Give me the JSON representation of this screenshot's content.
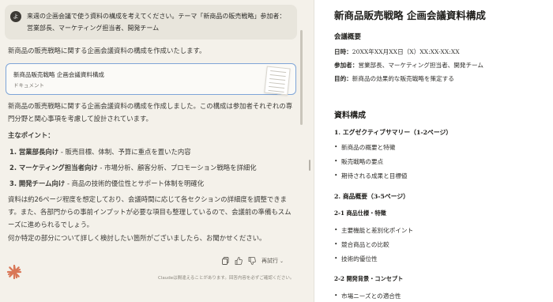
{
  "chat": {
    "user_avatar": "よ",
    "user_message": "来週の企画会議で使う資料の構成を考えてください。テーマ「新商品の販売戦略」参加者：営業部長、マーケティング担当者、開発チーム",
    "intro": "新商品の販売戦略に関する企画会議資料の構成を作成いたします。",
    "document_card": {
      "title": "新商品販売戦略 企画会議資料構成",
      "type": "ドキュメント"
    },
    "summary": "新商品の販売戦略に関する企画会議資料の構成を作成しました。この構成は参加者それぞれの専門分野と関心事項を考慮して設計されています。",
    "points_heading": "主なポイント：",
    "points": [
      {
        "label": "1. 営業部長向け",
        "text": " - 販売目標、体制、予算に重点を置いた内容"
      },
      {
        "label": "2. マーケティング担当者向け",
        "text": " - 市場分析、顧客分析、プロモーション戦略を詳細化"
      },
      {
        "label": "3. 開発チーム向け",
        "text": " - 商品の技術的優位性とサポート体制を明確化"
      }
    ],
    "paragraph2": "資料は約26ページ程度を想定しており、会議時間に応じて各セクションの詳細度を調整できます。また、各部門からの事前インプットが必要な項目も整理しているので、会議前の準備もスムーズに進められるでしょう。",
    "paragraph3": "何か特定の部分について詳しく検討したい箇所がございましたら、お聞かせください。",
    "actions": {
      "copy_icon": "copy-icon",
      "thumbs_up_icon": "thumbs-up-icon",
      "thumbs_down_icon": "thumbs-down-icon",
      "retry_label": "再試行"
    },
    "disclaimer": "Claudeは間違えることがあります。回答内容を必ずご確認ください。"
  },
  "document": {
    "title": "新商品販売戦略 企画会議資料構成",
    "overview_heading": "会議概要",
    "overview": [
      {
        "label": "日時：",
        "value": "20XX年XX月XX日（X）XX:XX-XX:XX"
      },
      {
        "label": "参加者：",
        "value": "営業部長、マーケティング担当者、開発チーム"
      },
      {
        "label": "目的：",
        "value": "新商品の効果的な販売戦略を策定する"
      }
    ],
    "structure_heading": "資料構成",
    "section1": {
      "heading": "1. エグゼクティブサマリー（1-2ページ）",
      "items": [
        "新商品の概要と特徴",
        "販売戦略の要点",
        "期待される成果と目標値"
      ]
    },
    "section2": {
      "heading": "2. 商品概要（3-5ページ）",
      "sub1": {
        "heading": "2-1 商品仕様・特徴",
        "items": [
          "主要機能と差別化ポイント",
          "競合商品との比較",
          "技術的優位性"
        ]
      },
      "sub2": {
        "heading": "2-2 開発背景・コンセプト",
        "items": [
          "市場ニーズとの適合性"
        ]
      }
    }
  }
}
